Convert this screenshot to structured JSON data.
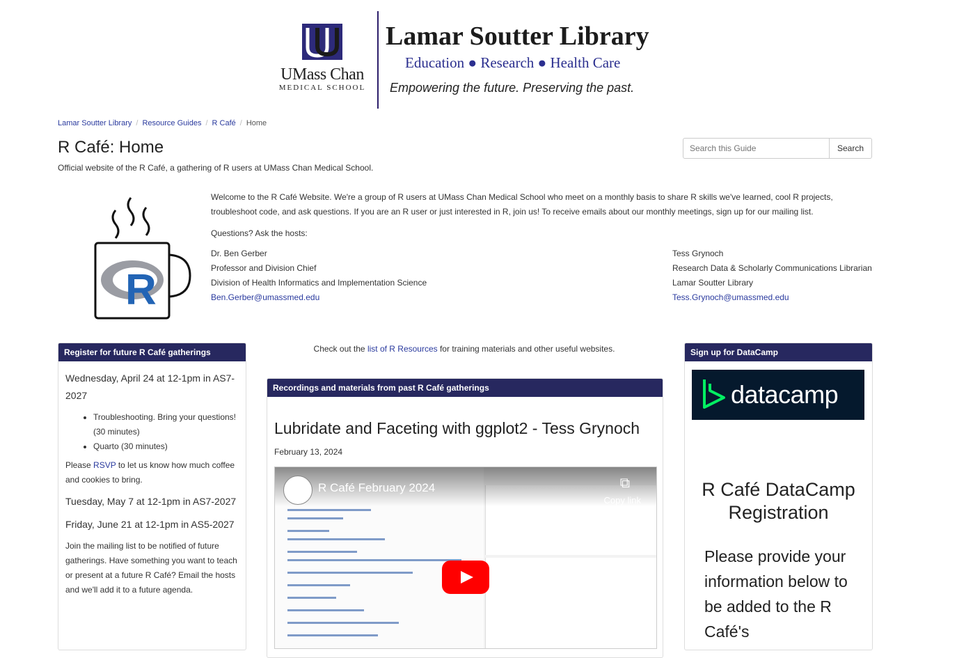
{
  "banner": {
    "uc_name": "UMass Chan",
    "uc_sub": "MEDICAL SCHOOL",
    "library_title": "Lamar Soutter Library",
    "tagline": "Education ● Research ● Health Care",
    "motto": "Empowering the future. Preserving the past."
  },
  "breadcrumb": {
    "items": [
      "Lamar Soutter Library",
      "Resource Guides",
      "R Café"
    ],
    "current": "Home",
    "separator": "/"
  },
  "page": {
    "title": "R Café: Home",
    "description": "Official website of the R Café, a gathering of R users at UMass Chan Medical School."
  },
  "search": {
    "placeholder": "Search this Guide",
    "button_label": "Search"
  },
  "intro": {
    "welcome": "Welcome to the R Café Website. We're a group of R users at UMass Chan Medical School who meet on a monthly basis to share R skills we've learned, cool R projects, troubleshoot code, and ask questions. If you are an R user or just interested in R, join us! To receive emails about our monthly meetings, sign up for our mailing list.",
    "questions": "Questions? Ask the hosts:",
    "hosts": [
      {
        "name": "Dr. Ben Gerber",
        "title": "Professor and Division Chief",
        "dept": "Division of Health Informatics and Implementation Science",
        "email": "Ben.Gerber@umassmed.edu"
      },
      {
        "name": "Tess Grynoch",
        "title": "Research Data & Scholarly Communications Librarian",
        "dept": "Lamar Soutter Library",
        "email": "Tess.Grynoch@umassmed.edu"
      }
    ]
  },
  "left_panel": {
    "heading": "Register for future R Café gatherings",
    "event1": "Wednesday, April 24 at 12-1pm in AS7-2027",
    "event1_items": [
      "Troubleshooting. Bring your questions! (30 minutes)",
      "Quarto (30 minutes)"
    ],
    "rsvp_before": "Please ",
    "rsvp_link": "RSVP",
    "rsvp_after": " to let us know how much coffee and cookies to bring.",
    "event2": "Tuesday, May 7 at 12-1pm in AS7-2027",
    "event3": "Friday, June 21 at 12-1pm in AS5-2027",
    "mailing": "Join the mailing list to be notified of future gatherings. Have something you want to teach or present at a future R Café? Email the hosts and we'll add it to a future agenda."
  },
  "mid_note": {
    "before": "Check out the ",
    "link": "list of R Resources",
    "after": " for training materials and other useful websites."
  },
  "mid_panel": {
    "heading": "Recordings and materials from past R Café gatherings",
    "post_title": "Lubridate and Faceting with ggplot2 - Tess Grynoch",
    "post_date": "February 13, 2024",
    "video_title": "R Café February 2024",
    "copy_label": "Copy link"
  },
  "right_panel": {
    "heading": "Sign up for DataCamp",
    "logo_text": "datacamp",
    "form_title": "R Café DataCamp Registration",
    "form_text": "Please provide your information below to be added to the R Café's"
  },
  "colors": {
    "panel_header": "#27285f",
    "link": "#2a3a9e",
    "datacamp_bg": "#05192d",
    "datacamp_green": "#03ef62"
  }
}
